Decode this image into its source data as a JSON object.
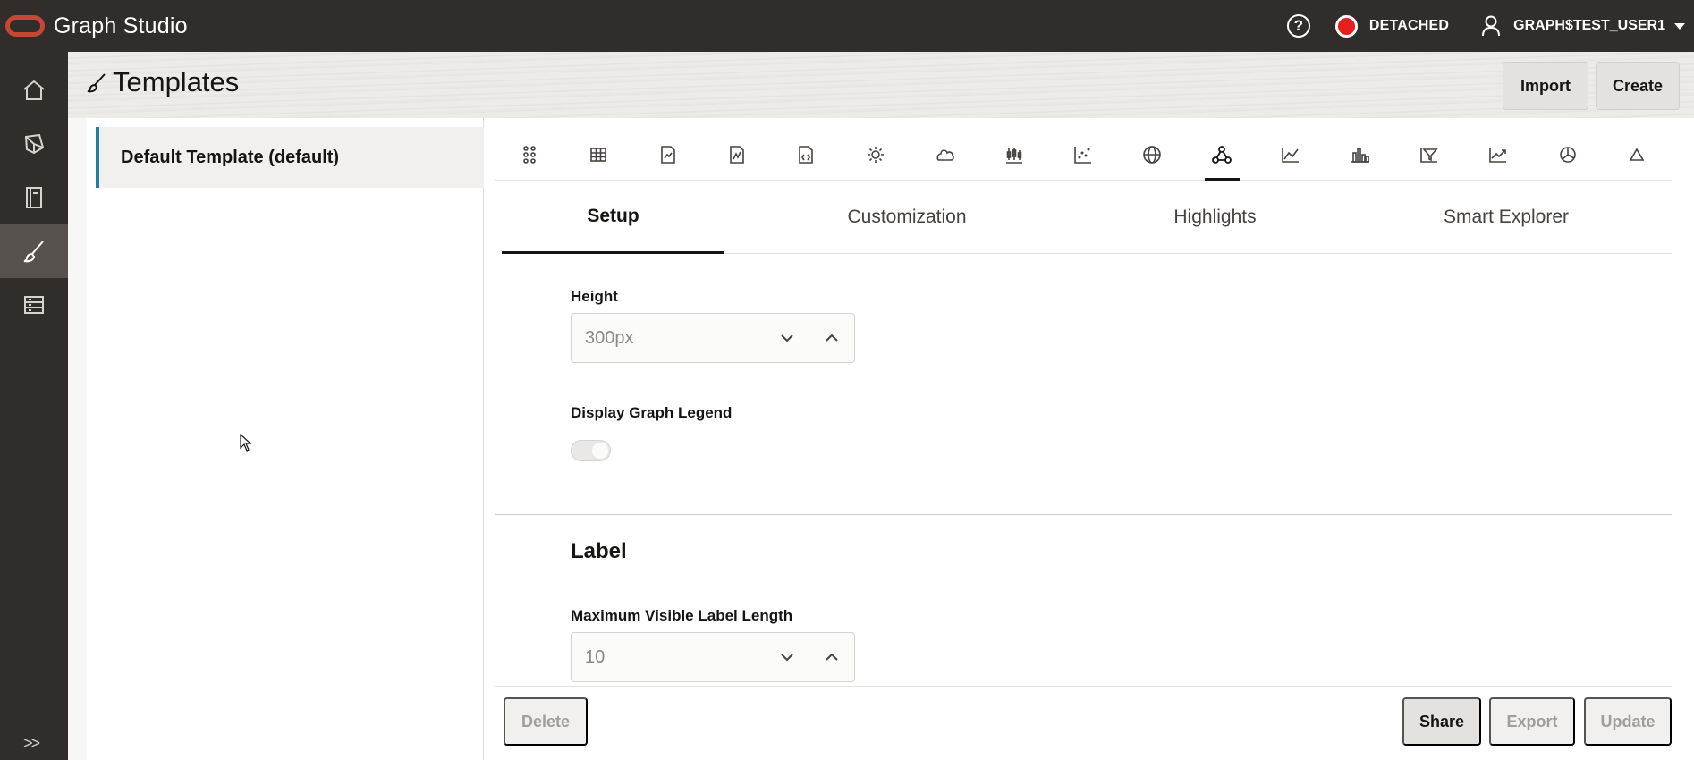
{
  "app": {
    "title": "Graph Studio"
  },
  "header": {
    "help_icon": "help-icon",
    "status": {
      "label": "DETACHED",
      "color": "#e61e1e"
    },
    "user": {
      "name": "GRAPH$TEST_USER1"
    }
  },
  "sidebar": {
    "items": [
      {
        "icon": "home-icon",
        "active": false
      },
      {
        "icon": "graph-model-icon",
        "active": false
      },
      {
        "icon": "notebook-icon",
        "active": false
      },
      {
        "icon": "brush-icon",
        "active": true
      },
      {
        "icon": "jobs-icon",
        "active": false
      }
    ],
    "expand_label": ">>"
  },
  "page": {
    "title": "Templates",
    "import_label": "Import",
    "create_label": "Create"
  },
  "templates": {
    "items": [
      {
        "label": "Default Template (default)",
        "selected": true
      }
    ]
  },
  "visualizations": {
    "icons": [
      "dots-icon",
      "table-icon",
      "chart-doc-icon",
      "chart-doc-alt-icon",
      "code-doc-icon",
      "sun-icon",
      "cloud-icon",
      "candlestick-icon",
      "scatter-icon",
      "globe-icon",
      "graph-network-icon",
      "line-chart-icon",
      "bar-chart-icon",
      "funnel-icon",
      "trend-line-icon",
      "pie-chart-icon",
      "triangle-icon"
    ],
    "active_index": 10
  },
  "tabs": [
    {
      "label": "Setup",
      "active": true
    },
    {
      "label": "Customization",
      "active": false
    },
    {
      "label": "Highlights",
      "active": false
    },
    {
      "label": "Smart Explorer",
      "active": false
    }
  ],
  "form": {
    "height": {
      "label": "Height",
      "value": "300px"
    },
    "legend": {
      "label": "Display Graph Legend",
      "enabled": false
    },
    "label_section": {
      "title": "Label"
    },
    "max_label_length": {
      "label": "Maximum Visible Label Length",
      "value": "10"
    }
  },
  "footer": {
    "delete_label": "Delete",
    "share_label": "Share",
    "export_label": "Export",
    "update_label": "Update"
  }
}
